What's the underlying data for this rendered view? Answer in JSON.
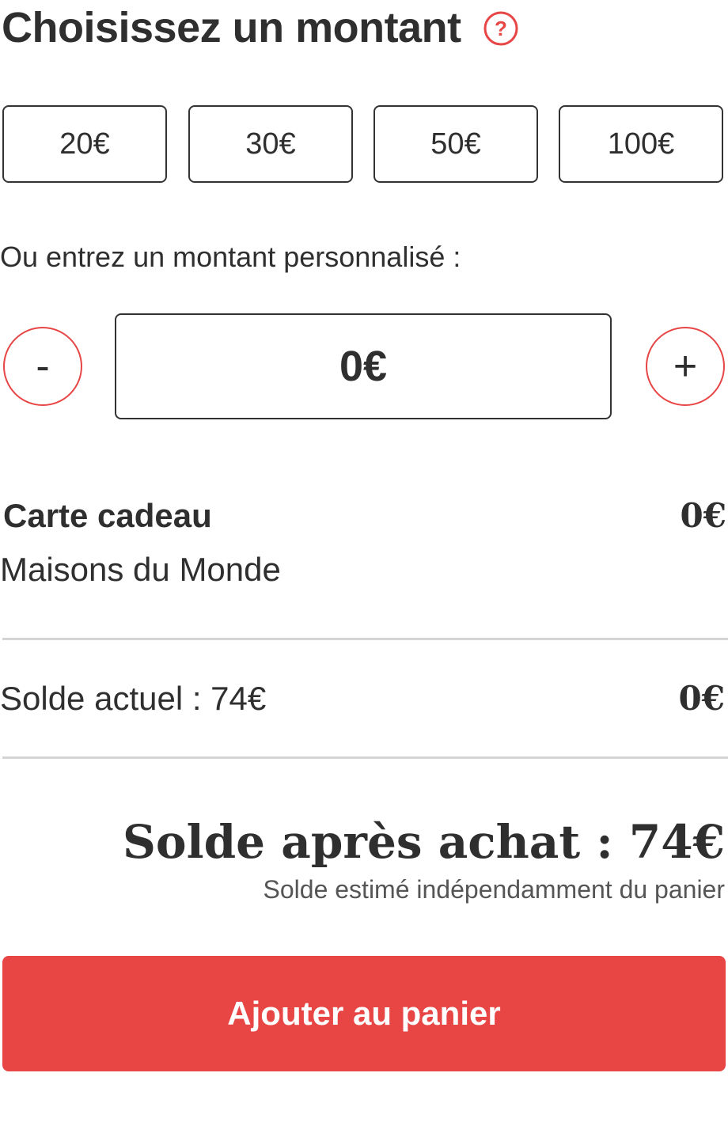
{
  "header": {
    "title": "Choisissez un montant",
    "help_icon": "question-circle-icon",
    "help_symbol": "?"
  },
  "presets": [
    {
      "label": "20€"
    },
    {
      "label": "30€"
    },
    {
      "label": "50€"
    },
    {
      "label": "100€"
    }
  ],
  "custom_amount": {
    "label": "Ou entrez un montant personnalisé :",
    "value": "0€",
    "decrement_label": "-",
    "increment_label": "+"
  },
  "summary": {
    "card_title": "Carte cadeau",
    "card_brand": "Maisons du Monde",
    "card_amount": "0€",
    "balance_label": "Solde actuel : 74€",
    "balance_amount": "0€",
    "after_purchase": "Solde après achat : 74€",
    "after_note": "Solde estimé indépendamment du panier"
  },
  "actions": {
    "add_to_cart": "Ajouter au panier"
  },
  "colors": {
    "accent": "#e84545",
    "text": "#2f2f2f",
    "divider": "#d4d4d4",
    "muted": "#555555"
  }
}
